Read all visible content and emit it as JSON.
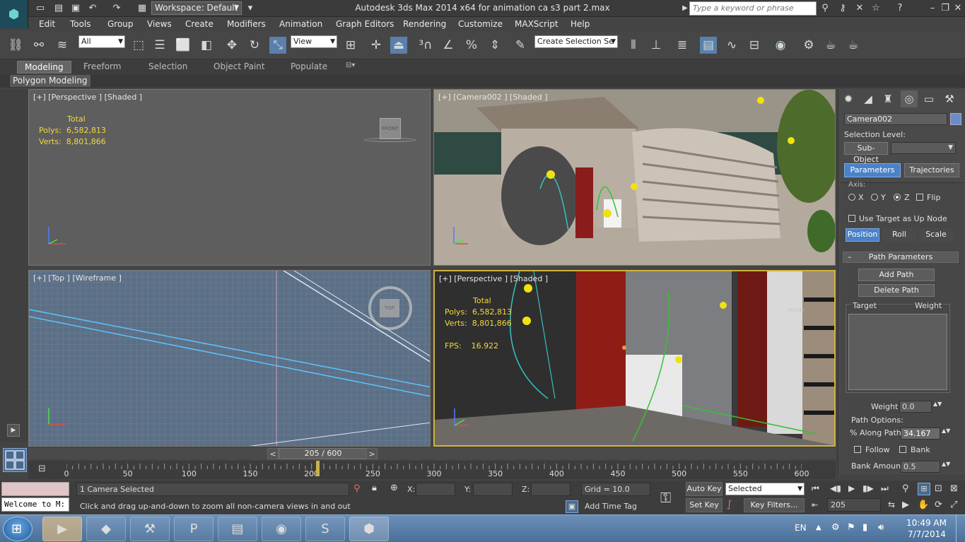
{
  "window": {
    "title": "Autodesk 3ds Max  2014 x64      for animation ca s3 part 2.max",
    "workspace": "Workspace: Default",
    "search_placeholder": "Type a keyword or phrase"
  },
  "menu": [
    "Edit",
    "Tools",
    "Group",
    "Views",
    "Create",
    "Modifiers",
    "Animation",
    "Graph Editors",
    "Rendering",
    "Customize",
    "MAXScript",
    "Help"
  ],
  "toolbar": {
    "selection_filter": "All",
    "reference_coord": "View",
    "named_selection": "Create Selection Se"
  },
  "ribbon": {
    "tabs": [
      "Modeling",
      "Freeform",
      "Selection",
      "Object Paint",
      "Populate"
    ],
    "panel_label": "Polygon Modeling"
  },
  "viewports": {
    "top_left": {
      "label": "[+] [Perspective ] [Shaded ]",
      "stats_header": "Total",
      "polys_label": "Polys:",
      "polys_value": "6,582,813",
      "verts_label": "Verts:",
      "verts_value": "8,801,866",
      "viewcube": "FRONT"
    },
    "top_right": {
      "label": "[+] [Camera002 ] [Shaded ]"
    },
    "bottom_left": {
      "label": "[+] [Top ] [Wireframe ]",
      "viewcube": "TOP"
    },
    "bottom_right": {
      "label": "[+] [Perspective ] [Shaded ]",
      "stats_header": "Total",
      "polys_label": "Polys:",
      "polys_value": "6,582,813",
      "verts_label": "Verts:",
      "verts_value": "8,801,866",
      "fps_label": "FPS:",
      "fps_value": "16.922",
      "viewcube": "FRONT"
    }
  },
  "command_panel": {
    "object_name": "Camera002",
    "selection_level_label": "Selection Level:",
    "sub_object_label": "Sub-Object",
    "tab_parameters": "Parameters",
    "tab_trajectories": "Trajectories",
    "axis_label": "Axis:",
    "axis_x": "X",
    "axis_y": "Y",
    "axis_z": "Z",
    "flip_label": "Flip",
    "use_target_label": "Use Target as Up Node",
    "btn_position": "Position",
    "btn_roll": "Roll",
    "btn_scale": "Scale",
    "path_params_label": "Path Parameters",
    "add_path": "Add Path",
    "delete_path": "Delete Path",
    "target_col": "Target",
    "weight_col": "Weight",
    "weight_label": "Weight",
    "weight_value": "0.0",
    "path_options_label": "Path Options:",
    "along_path_label": "% Along Path:",
    "along_path_value": "34.167",
    "follow_label": "Follow",
    "bank_label": "Bank",
    "bank_amount_label": "Bank Amount:",
    "bank_amount_value": "0.5"
  },
  "timeline": {
    "frame_display": "205 / 600",
    "current_frame": 205,
    "total_frames": 600,
    "ticks": [
      "0",
      "50",
      "100",
      "150",
      "200",
      "250",
      "300",
      "350",
      "400",
      "450",
      "500",
      "550",
      "600"
    ]
  },
  "status": {
    "maxscript_text": "Welcome to M:",
    "selection_text": "1 Camera Selected",
    "prompt_text": "Click and drag up-and-down to zoom all non-camera views in and out",
    "x_label": "X:",
    "y_label": "Y:",
    "z_label": "Z:",
    "grid_text": "Grid = 10.0",
    "add_time_tag": "Add Time Tag",
    "auto_key": "Auto Key",
    "set_key": "Set Key",
    "key_mode": "Selected",
    "key_filters": "Key Filters...",
    "frame_field": "205"
  },
  "taskbar": {
    "language": "EN",
    "time": "10:49 AM",
    "date": "7/7/2014"
  }
}
